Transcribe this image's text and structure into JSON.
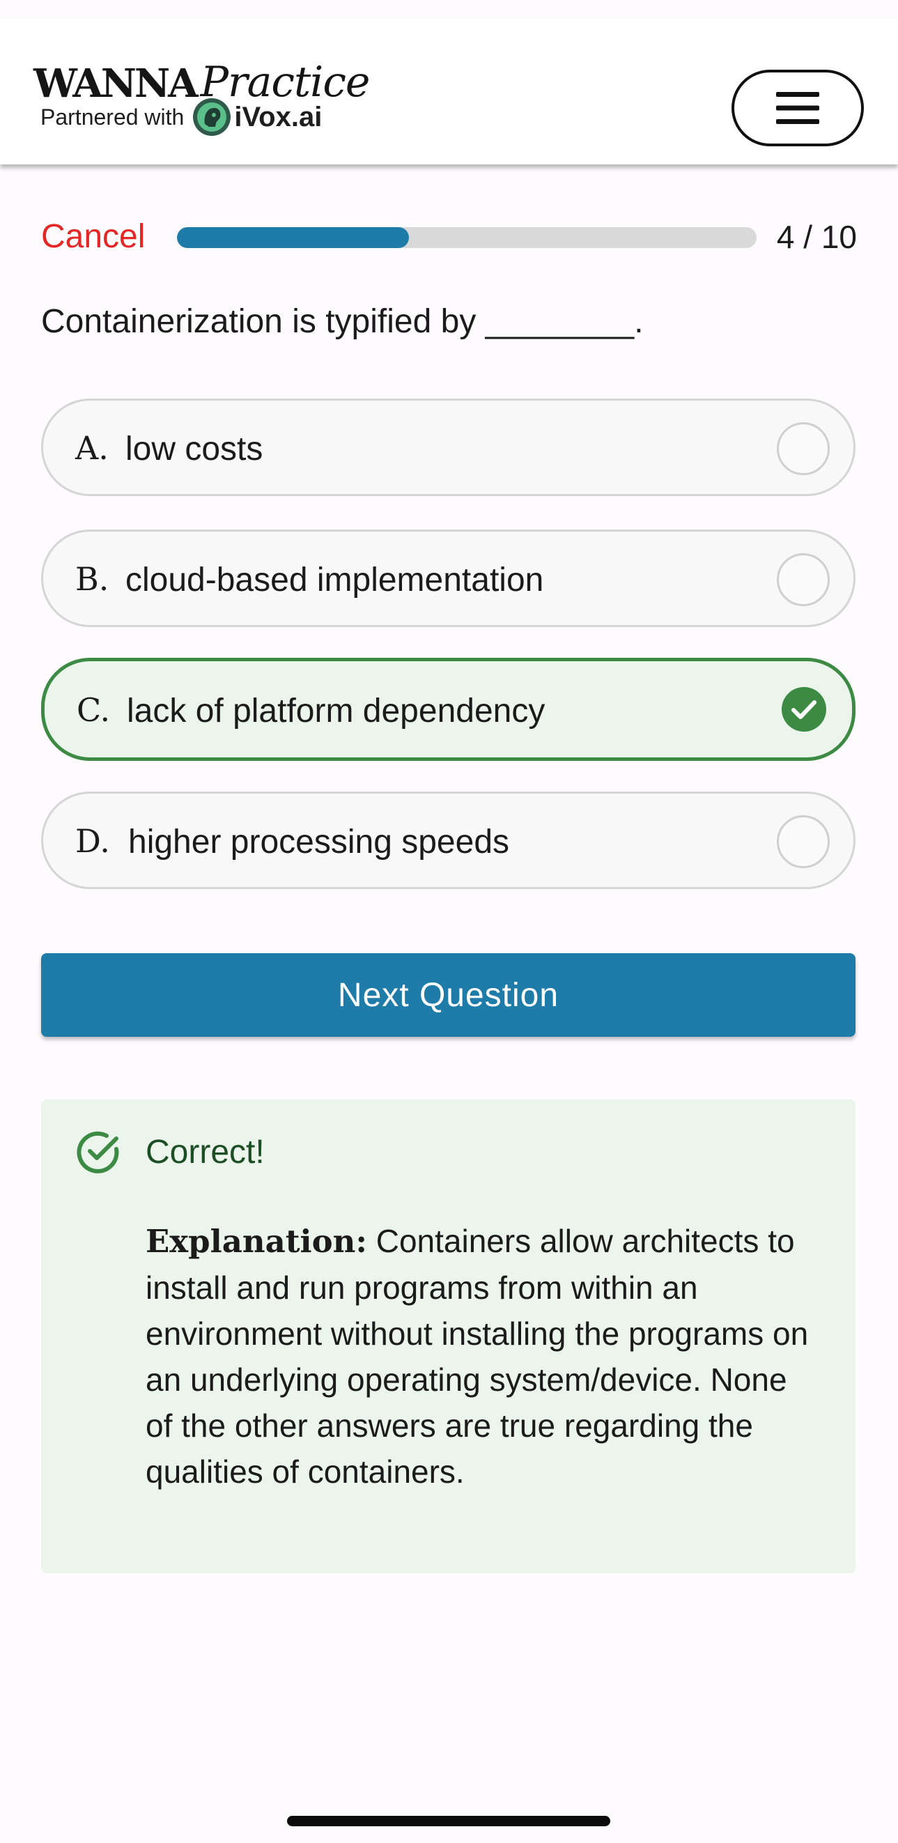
{
  "header": {
    "logo_wanna": "WANNA",
    "logo_practice": "Practice",
    "partner_text": "Partnered with",
    "partner_name": "iVox.ai",
    "menu_icon": "hamburger-icon"
  },
  "progress": {
    "cancel_label": "Cancel",
    "count_label": "4 / 10",
    "current": 4,
    "total": 10,
    "fill_fraction": 0.4
  },
  "question": {
    "text": "Containerization is typified by ________."
  },
  "options": [
    {
      "letter": "A.",
      "text": "low costs",
      "selected": false
    },
    {
      "letter": "B.",
      "text": "cloud-based implementation",
      "selected": false
    },
    {
      "letter": "C.",
      "text": "lack of platform dependency",
      "selected": true
    },
    {
      "letter": "D.",
      "text": "higher processing speeds",
      "selected": false
    }
  ],
  "next_button_label": "Next Question",
  "feedback": {
    "icon": "check-circle-icon",
    "title": "Correct!",
    "explanation_label": "Explanation:",
    "explanation_text": " Containers allow architects to install and run programs from within an environment without installing the programs on an underlying operating system/device. None of the other answers are true regarding the qualities of containers."
  },
  "colors": {
    "accent": "#1f7ba8",
    "cancel": "#e32626",
    "correct_border": "#3c8a44",
    "correct_background": "#ebf5eb",
    "correct_text": "#1d4d24"
  }
}
